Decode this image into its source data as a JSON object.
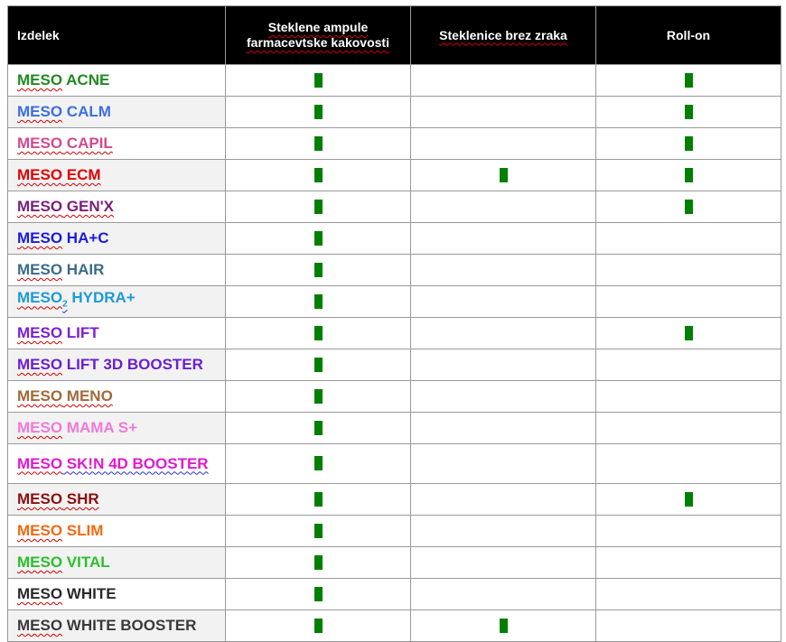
{
  "header": {
    "product": "Izdelek",
    "col1_line1": "Steklene ampule",
    "col1_line2": "farmacevtske kakovosti",
    "col2": "Steklenice brez zraka",
    "col3": "Roll-on"
  },
  "colors": {
    "mark": "#008000",
    "header_bg": "#000000"
  },
  "rows": [
    {
      "brand": "MESO",
      "rest": " ACNE",
      "color": "#1f8a1f",
      "ampule": true,
      "airless": false,
      "rollon": true
    },
    {
      "brand": "MESO",
      "rest": " CALM",
      "color": "#3b6fe0",
      "ampule": true,
      "airless": false,
      "rollon": true
    },
    {
      "brand": "MESO",
      "rest": " CAPIL",
      "color": "#d24a8c",
      "ampule": true,
      "airless": false,
      "rollon": true
    },
    {
      "brand": "MESO",
      "rest": " ECM",
      "color": "#e00000",
      "ampule": true,
      "airless": true,
      "rollon": true
    },
    {
      "brand": "MESO",
      "rest": " GEN'X",
      "color": "#7a1f7a",
      "ampule": true,
      "airless": false,
      "rollon": true
    },
    {
      "brand": "MESO",
      "rest": " HA+C",
      "color": "#1a1ae0",
      "ampule": true,
      "airless": false,
      "rollon": false
    },
    {
      "brand": "MESO",
      "rest": " HAIR",
      "color": "#3a6a8a",
      "ampule": true,
      "airless": false,
      "rollon": false
    },
    {
      "brand": "MESO",
      "sub": "2",
      "rest": " HYDRA+",
      "color": "#1e9ad6",
      "ampule": true,
      "airless": false,
      "rollon": false
    },
    {
      "brand": "MESO",
      "rest": " LIFT",
      "color": "#7a1fd6",
      "ampule": true,
      "airless": false,
      "rollon": true
    },
    {
      "brand": "MESO",
      "rest": " LIFT 3D BOOSTER",
      "color": "#6a1fd0",
      "ampule": true,
      "airless": false,
      "rollon": false
    },
    {
      "brand": "MESO",
      "rest": " MENO",
      "color": "#a06a3a",
      "ampule": true,
      "airless": false,
      "rollon": false
    },
    {
      "brand": "MESO",
      "rest": " MAMA S+",
      "color": "#f07ad8",
      "ampule": true,
      "airless": false,
      "rollon": false
    },
    {
      "brand": "MESO",
      "rest": " SK!N 4D BOOSTER",
      "color": "#e01ad0",
      "ampule": true,
      "airless": false,
      "rollon": false
    },
    {
      "brand": "MESO",
      "rest": " SHR",
      "color": "#8a1010",
      "ampule": true,
      "airless": false,
      "rollon": true
    },
    {
      "brand": "MESO",
      "rest": " SLIM",
      "color": "#f06a10",
      "ampule": true,
      "airless": false,
      "rollon": false
    },
    {
      "brand": "MESO",
      "rest": " VITAL",
      "color": "#2ac02a",
      "ampule": true,
      "airless": false,
      "rollon": false
    },
    {
      "brand": "MESO",
      "rest": " WHITE",
      "color": "#2a2a2a",
      "ampule": true,
      "airless": false,
      "rollon": false
    },
    {
      "brand": "MESO",
      "rest": " WHITE BOOSTER",
      "color": "#3a3a3a",
      "ampule": true,
      "airless": true,
      "rollon": false
    }
  ]
}
